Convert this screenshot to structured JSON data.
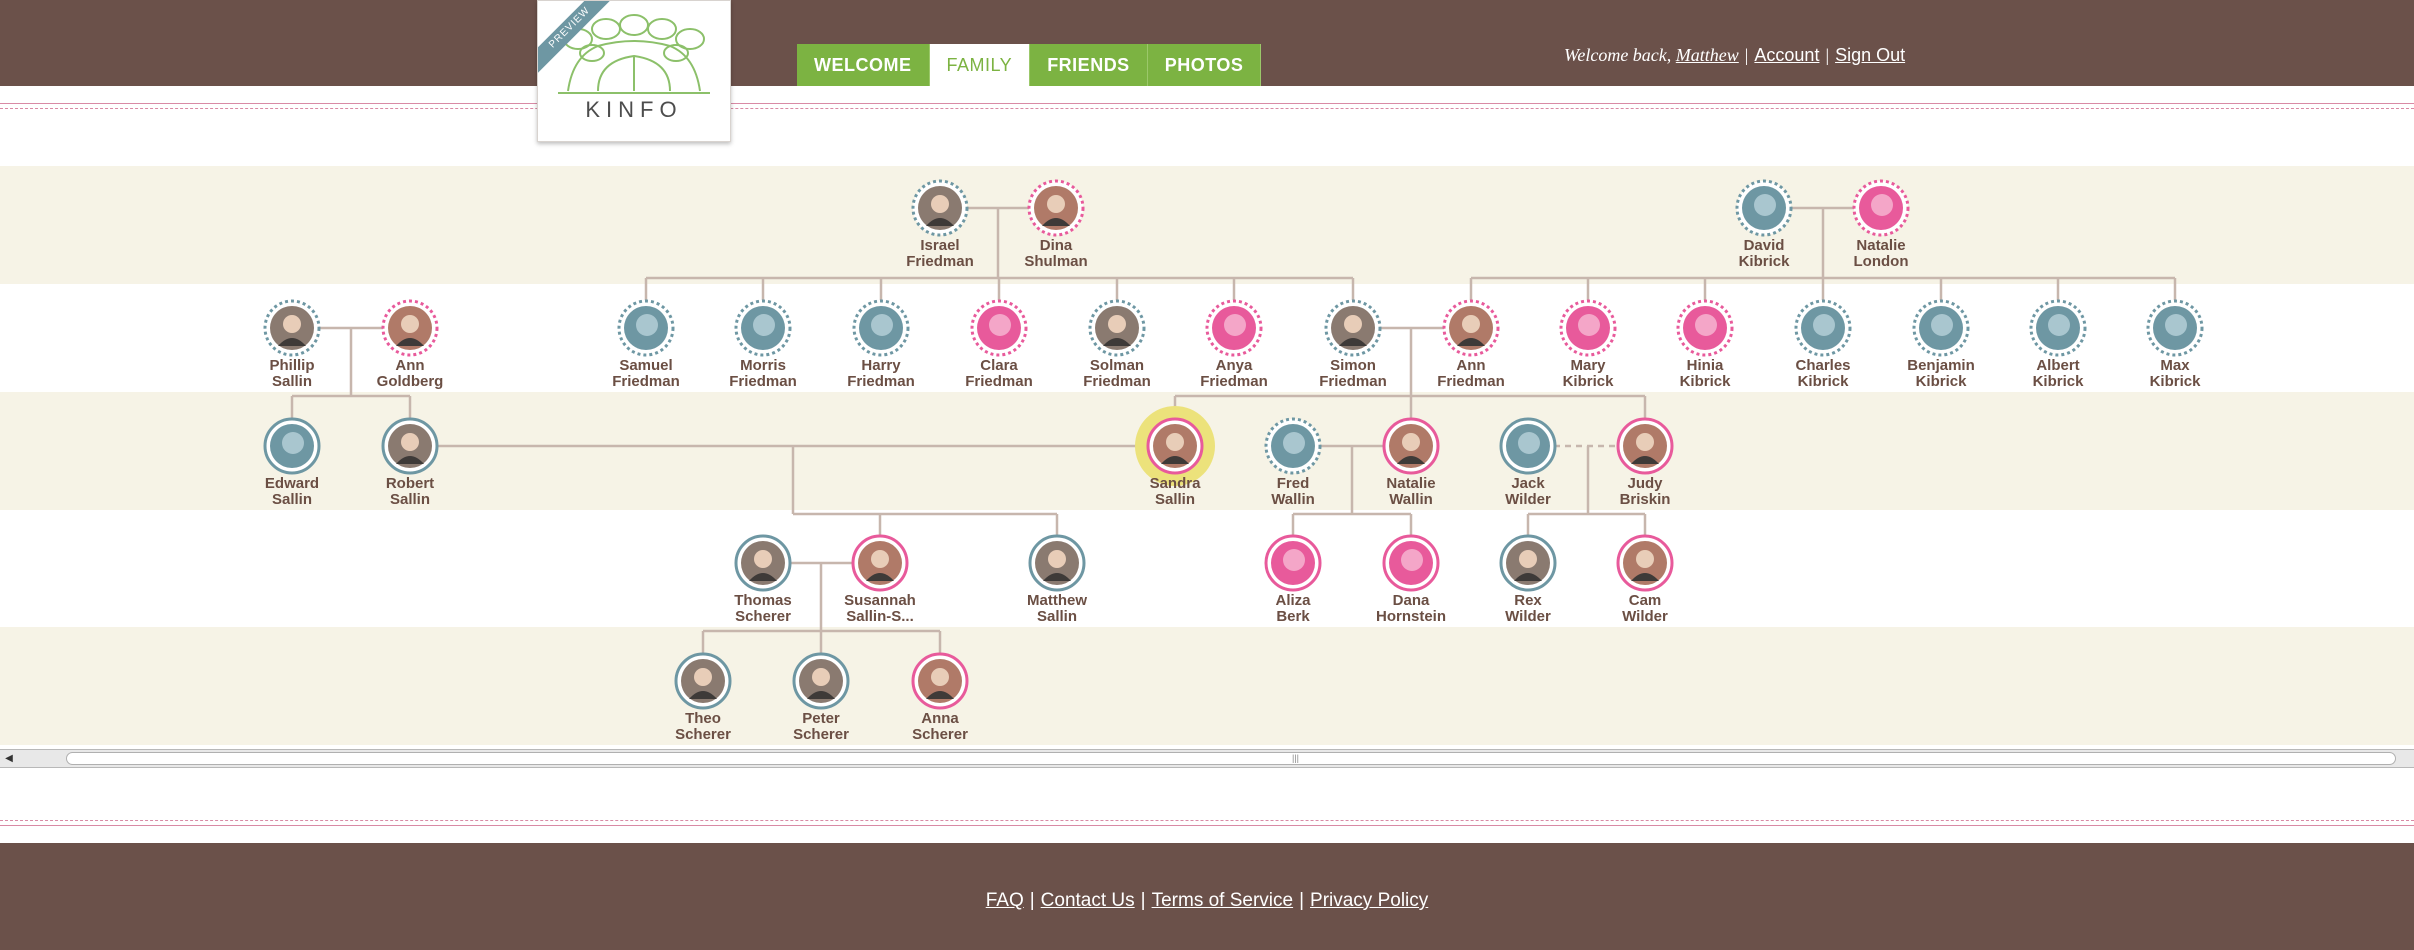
{
  "logo": {
    "text": "KINFO",
    "ribbon": "PREVIEW"
  },
  "nav": {
    "tabs": [
      {
        "label": "WELCOME",
        "active": false
      },
      {
        "label": "FAMILY",
        "active": true
      },
      {
        "label": "FRIENDS",
        "active": false
      },
      {
        "label": "PHOTOS",
        "active": false
      }
    ]
  },
  "user": {
    "greeting": "Welcome back,",
    "name": "Matthew",
    "account_label": "Account",
    "signout_label": "Sign Out"
  },
  "colors": {
    "header_bg": "#6b514a",
    "nav_green": "#7cb342",
    "male": "#6e97a3",
    "female": "#e85a9b",
    "line": "#c7b6ad",
    "band": "#f6f3e6",
    "highlight": "#ece27b"
  },
  "people": [
    {
      "id": "israel",
      "first": "Israel",
      "last": "Friedman",
      "gender": "male",
      "photo": true,
      "dashed": true
    },
    {
      "id": "dina",
      "first": "Dina",
      "last": "Shulman",
      "gender": "female",
      "photo": true,
      "dashed": true
    },
    {
      "id": "david",
      "first": "David",
      "last": "Kibrick",
      "gender": "male",
      "photo": false,
      "dashed": true
    },
    {
      "id": "natalieL",
      "first": "Natalie",
      "last": "London",
      "gender": "female",
      "photo": false,
      "dashed": true
    },
    {
      "id": "phillip",
      "first": "Phillip",
      "last": "Sallin",
      "gender": "male",
      "photo": true,
      "dashed": true
    },
    {
      "id": "annG",
      "first": "Ann",
      "last": "Goldberg",
      "gender": "female",
      "photo": true,
      "dashed": true
    },
    {
      "id": "samuel",
      "first": "Samuel",
      "last": "Friedman",
      "gender": "male",
      "photo": false,
      "dashed": true
    },
    {
      "id": "morris",
      "first": "Morris",
      "last": "Friedman",
      "gender": "male",
      "photo": false,
      "dashed": true
    },
    {
      "id": "harry",
      "first": "Harry",
      "last": "Friedman",
      "gender": "male",
      "photo": false,
      "dashed": true
    },
    {
      "id": "clara",
      "first": "Clara",
      "last": "Friedman",
      "gender": "female",
      "photo": false,
      "dashed": true
    },
    {
      "id": "solman",
      "first": "Solman",
      "last": "Friedman",
      "gender": "male",
      "photo": true,
      "dashed": true
    },
    {
      "id": "anya",
      "first": "Anya",
      "last": "Friedman",
      "gender": "female",
      "photo": false,
      "dashed": true
    },
    {
      "id": "simon",
      "first": "Simon",
      "last": "Friedman",
      "gender": "male",
      "photo": true,
      "dashed": true
    },
    {
      "id": "annF",
      "first": "Ann",
      "last": "Friedman",
      "gender": "female",
      "photo": true,
      "dashed": true
    },
    {
      "id": "mary",
      "first": "Mary",
      "last": "Kibrick",
      "gender": "female",
      "photo": false,
      "dashed": true
    },
    {
      "id": "hinia",
      "first": "Hinia",
      "last": "Kibrick",
      "gender": "female",
      "photo": false,
      "dashed": true
    },
    {
      "id": "charles",
      "first": "Charles",
      "last": "Kibrick",
      "gender": "male",
      "photo": false,
      "dashed": true
    },
    {
      "id": "benjamin",
      "first": "Benjamin",
      "last": "Kibrick",
      "gender": "male",
      "photo": false,
      "dashed": true
    },
    {
      "id": "albert",
      "first": "Albert",
      "last": "Kibrick",
      "gender": "male",
      "photo": false,
      "dashed": true
    },
    {
      "id": "max",
      "first": "Max",
      "last": "Kibrick",
      "gender": "male",
      "photo": false,
      "dashed": true
    },
    {
      "id": "edward",
      "first": "Edward",
      "last": "Sallin",
      "gender": "male",
      "photo": false,
      "dashed": false
    },
    {
      "id": "robert",
      "first": "Robert",
      "last": "Sallin",
      "gender": "male",
      "photo": true,
      "dashed": false
    },
    {
      "id": "sandra",
      "first": "Sandra",
      "last": "Sallin",
      "gender": "female",
      "photo": true,
      "dashed": false,
      "selected": true
    },
    {
      "id": "fred",
      "first": "Fred",
      "last": "Wallin",
      "gender": "male",
      "photo": false,
      "dashed": true
    },
    {
      "id": "natalieW",
      "first": "Natalie",
      "last": "Wallin",
      "gender": "female",
      "photo": true,
      "dashed": false
    },
    {
      "id": "jack",
      "first": "Jack",
      "last": "Wilder",
      "gender": "male",
      "photo": false,
      "dashed": false
    },
    {
      "id": "judy",
      "first": "Judy",
      "last": "Briskin",
      "gender": "female",
      "photo": true,
      "dashed": false
    },
    {
      "id": "thomas",
      "first": "Thomas",
      "last": "Scherer",
      "gender": "male",
      "photo": true,
      "dashed": false
    },
    {
      "id": "susannah",
      "first": "Susannah",
      "last": "Sallin-S...",
      "gender": "female",
      "photo": true,
      "dashed": false
    },
    {
      "id": "matthew",
      "first": "Matthew",
      "last": "Sallin",
      "gender": "male",
      "photo": true,
      "dashed": false
    },
    {
      "id": "aliza",
      "first": "Aliza",
      "last": "Berk",
      "gender": "female",
      "photo": false,
      "dashed": false
    },
    {
      "id": "dana",
      "first": "Dana",
      "last": "Hornstein",
      "gender": "female",
      "photo": false,
      "dashed": false
    },
    {
      "id": "rex",
      "first": "Rex",
      "last": "Wilder",
      "gender": "male",
      "photo": true,
      "dashed": false
    },
    {
      "id": "cam",
      "first": "Cam",
      "last": "Wilder",
      "gender": "female",
      "photo": true,
      "dashed": false
    },
    {
      "id": "theo",
      "first": "Theo",
      "last": "Scherer",
      "gender": "male",
      "photo": true,
      "dashed": false
    },
    {
      "id": "peter",
      "first": "Peter",
      "last": "Scherer",
      "gender": "male",
      "photo": true,
      "dashed": false
    },
    {
      "id": "anna",
      "first": "Anna",
      "last": "Scherer",
      "gender": "female",
      "photo": true,
      "dashed": false
    }
  ],
  "footer": {
    "faq": "FAQ",
    "contact": "Contact Us",
    "terms": "Terms of Service",
    "privacy": "Privacy Policy"
  }
}
